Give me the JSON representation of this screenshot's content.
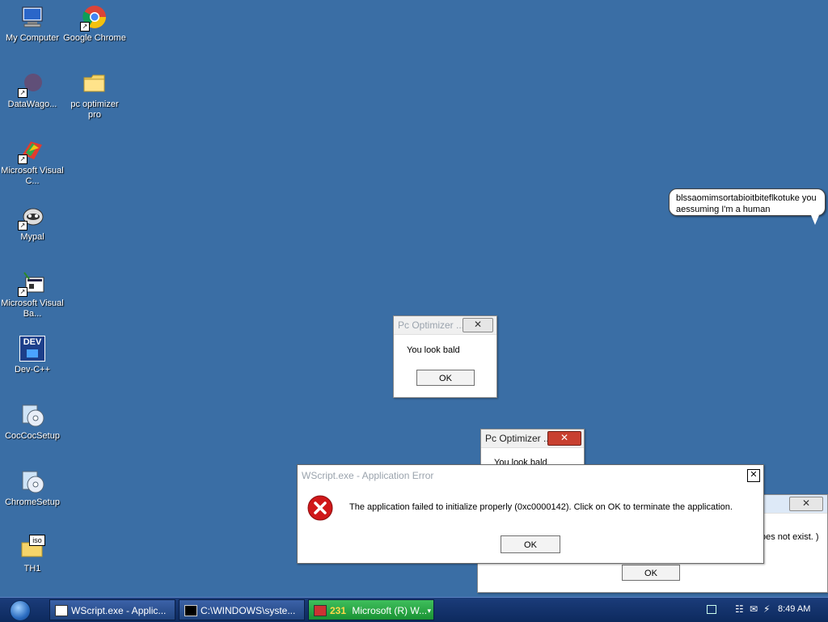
{
  "desktop": {
    "icons": [
      {
        "label": "My Computer",
        "icon": "computer-icon"
      },
      {
        "label": "Google Chrome",
        "icon": "chrome-icon"
      },
      {
        "label": "DataWago...",
        "icon": "datawago-icon"
      },
      {
        "label": "pc optimizer pro",
        "icon": "folder-icon"
      },
      {
        "label": "Microsoft Visual C...",
        "icon": "visual-c-icon"
      },
      {
        "label": "Mypal",
        "icon": "mypal-icon"
      },
      {
        "label": "Microsoft Visual Ba...",
        "icon": "visual-basic-icon"
      },
      {
        "label": "Dev-C++",
        "icon": "devcpp-icon"
      },
      {
        "label": "CocCocSetup",
        "icon": "setup-disc-icon"
      },
      {
        "label": "ChromeSetup",
        "icon": "setup-disc-icon"
      },
      {
        "label": "TH1",
        "icon": "iso-folder-icon"
      }
    ],
    "dev_badge": "DEV",
    "iso_badge": "iso"
  },
  "balloon": {
    "text": "blssaomimsortabioitbiteflkotuke you aessuming I'm a human"
  },
  "dialog_pc1": {
    "title": "Pc Optimizer ...",
    "message": "You look bald",
    "ok": "OK",
    "close": "✕"
  },
  "dialog_pc2": {
    "title": "Pc Optimizer ...",
    "message": "You look bald",
    "close": "✕"
  },
  "dialog_back": {
    "message_fragment": "oes not exist. )",
    "ok": "OK",
    "close": "✕"
  },
  "dialog_error": {
    "title": "WScript.exe - Application Error",
    "message": "The application failed to initialize properly (0xc0000142). Click on OK to terminate the application.",
    "ok": "OK",
    "close": "✕"
  },
  "taskbar": {
    "tasks": [
      {
        "label": "WScript.exe - Applic...",
        "active": false
      },
      {
        "label": "C:\\WINDOWS\\syste...",
        "active": false
      },
      {
        "label": "Microsoft (R) W...",
        "count": "231",
        "active": true
      }
    ],
    "clock": "8:49 AM"
  },
  "colors": {
    "desktop": "#3a6ea5",
    "error_red": "#d0181a",
    "taskbar": "#1b3c7a"
  }
}
